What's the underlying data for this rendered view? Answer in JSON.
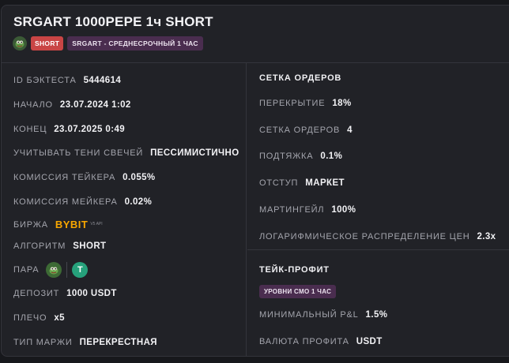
{
  "header": {
    "title": "SRGART 1000PEPE 1ч SHORT",
    "badge_direction": "SHORT",
    "badge_strategy": "SRGART - СРЕДНЕСРОЧНЫЙ 1 ЧАС",
    "avatar_icon": "pepe-avatar-icon"
  },
  "left": {
    "backtest_id": {
      "label": "ID БЭКТЕСТА",
      "value": "5444614"
    },
    "start": {
      "label": "НАЧАЛО",
      "value": "23.07.2024 1:02"
    },
    "end": {
      "label": "КОНЕЦ",
      "value": "23.07.2025 0:49"
    },
    "shadows": {
      "label": "УЧИТЫВАТЬ ТЕНИ СВЕЧЕЙ",
      "value": "ПЕССИМИСТИЧНО"
    },
    "taker_fee": {
      "label": "КОМИССИЯ ТЕЙКЕРА",
      "value": "0.055%"
    },
    "maker_fee": {
      "label": "КОМИССИЯ МЕЙКЕРА",
      "value": "0.02%"
    },
    "exchange": {
      "label": "БИРЖА",
      "value": "BYBIT",
      "sub": "V5 API"
    },
    "algorithm": {
      "label": "АЛГОРИТМ",
      "value": "SHORT"
    },
    "pair": {
      "label": "ПАРА",
      "base_icon": "pepe-coin-icon",
      "quote_icon": "usdt-coin-icon",
      "quote_glyph": "T"
    },
    "deposit": {
      "label": "ДЕПОЗИТ",
      "value": "1000 USDT"
    },
    "leverage": {
      "label": "ПЛЕЧО",
      "value": "x5"
    },
    "margin_type": {
      "label": "ТИП МАРЖИ",
      "value": "ПЕРЕКРЕСТНАЯ"
    }
  },
  "right": {
    "grid": {
      "title": "СЕТКА ОРДЕРОВ",
      "overlap": {
        "label": "ПЕРЕКРЫТИЕ",
        "value": "18%"
      },
      "orders": {
        "label": "СЕТКА ОРДЕРОВ",
        "value": "4"
      },
      "pullup": {
        "label": "ПОДТЯЖКА",
        "value": "0.1%"
      },
      "indent": {
        "label": "ОТСТУП",
        "value": "МАРКЕТ"
      },
      "martingale": {
        "label": "МАРТИНГЕЙЛ",
        "value": "100%"
      },
      "log_dist": {
        "label": "ЛОГАРИФМИЧЕСКОЕ РАСПРЕДЕЛЕНИЕ ЦЕН",
        "value": "2.3x"
      }
    },
    "take_profit": {
      "title": "ТЕЙК-ПРОФИТ",
      "badge": "УРОВНИ СМО 1 ЧАС",
      "min_pnl": {
        "label": "МИНИМАЛЬНЫЙ P&L",
        "value": "1.5%"
      },
      "currency": {
        "label": "ВАЛЮТА ПРОФИТА",
        "value": "USDT"
      }
    }
  }
}
